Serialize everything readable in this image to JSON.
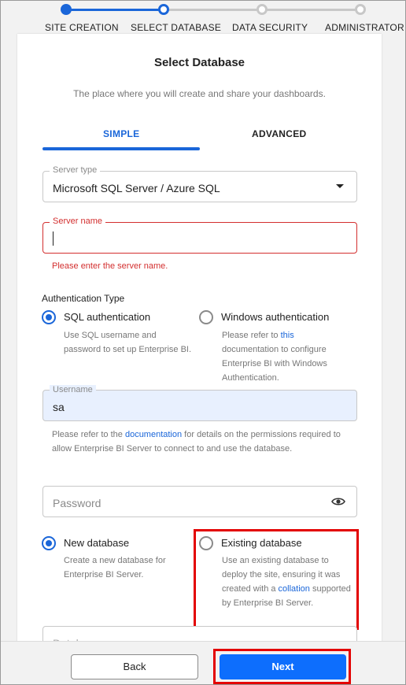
{
  "stepper": {
    "steps": [
      "SITE CREATION",
      "SELECT DATABASE",
      "DATA SECURITY",
      "ADMINISTRATOR"
    ],
    "active_color": "#1a66d9",
    "inactive_color": "#c8c8c8"
  },
  "card": {
    "title": "Select Database",
    "subtitle": "The place where you will create and share your dashboards.",
    "tabs": [
      "SIMPLE",
      "ADVANCED"
    ],
    "selected_tab": "SIMPLE"
  },
  "server_type": {
    "label": "Server type",
    "value": "Microsoft SQL Server / Azure SQL",
    "icon": "caret-down-icon"
  },
  "server_name": {
    "label": "Server name",
    "value": "",
    "error": "Please enter the server name."
  },
  "auth": {
    "section_label": "Authentication Type",
    "sql_label": "SQL authentication",
    "sql_help": "Use SQL username and password to set up Enterprise BI.",
    "windows_label": "Windows authentication",
    "windows_help_prefix": "Please refer to ",
    "windows_help_link": "this",
    "windows_help_suffix": " documentation to configure Enterprise BI with Windows Authentication.",
    "selected": "sql"
  },
  "username": {
    "label": "Username",
    "value": "sa",
    "help_prefix": "Please refer to the ",
    "help_link": "documentation",
    "help_suffix": " for details on the permissions required to allow Enterprise BI Server to connect to and use the database."
  },
  "password": {
    "placeholder": "Password",
    "icon": "eye-icon"
  },
  "database": {
    "new_label": "New database",
    "new_help": "Create a new database for Enterprise BI Server.",
    "existing_label": "Existing database",
    "existing_help_prefix": "Use an existing database to deploy the site, ensuring it was created with a ",
    "existing_help_link": "collation",
    "existing_help_suffix": " supported by Enterprise BI Server.",
    "selected": "new",
    "name_placeholder": "Database name"
  },
  "footer": {
    "back_label": "Back",
    "next_label": "Next"
  },
  "colors": {
    "accent": "#1a66d9",
    "error": "#d32f2f",
    "highlight": "#e30000",
    "autofill": "#e8f0fe"
  }
}
